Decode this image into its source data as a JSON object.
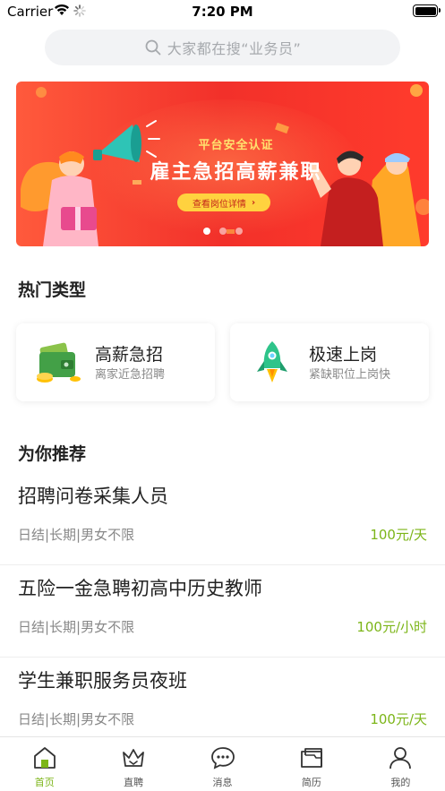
{
  "status_bar": {
    "carrier": "Carrier",
    "time": "7:20 PM"
  },
  "search": {
    "placeholder": "大家都在搜“业务员”"
  },
  "banner": {
    "tag": "平台安全认证",
    "title": "雇主急招高薪兼职",
    "button": "查看岗位详情",
    "dots": 3,
    "active_dot": 0
  },
  "hot_types": {
    "title": "热门类型",
    "cards": [
      {
        "title": "高薪急招",
        "subtitle": "离家近急招聘",
        "icon": "wallet-money-icon"
      },
      {
        "title": "极速上岗",
        "subtitle": "紧缺职位上岗快",
        "icon": "rocket-icon"
      }
    ]
  },
  "recommend": {
    "title": "为你推荐",
    "jobs": [
      {
        "title": "招聘问卷采集人员",
        "tags": "日结|长期|男女不限",
        "pay": "100元/天"
      },
      {
        "title": "五险一金急聘初高中历史教师",
        "tags": "日结|长期|男女不限",
        "pay": "100元/小时"
      },
      {
        "title": "学生兼职服务员夜班",
        "tags": "日结|长期|男女不限",
        "pay": "100元/天"
      }
    ]
  },
  "tabbar": {
    "active_color": "#7cb518",
    "items": [
      {
        "label": "首页",
        "icon": "home-icon",
        "active": true
      },
      {
        "label": "直聘",
        "icon": "crown-icon",
        "active": false
      },
      {
        "label": "消息",
        "icon": "chat-bubble-icon",
        "active": false
      },
      {
        "label": "简历",
        "icon": "folder-icon",
        "active": false
      },
      {
        "label": "我的",
        "icon": "person-icon",
        "active": false
      }
    ]
  }
}
